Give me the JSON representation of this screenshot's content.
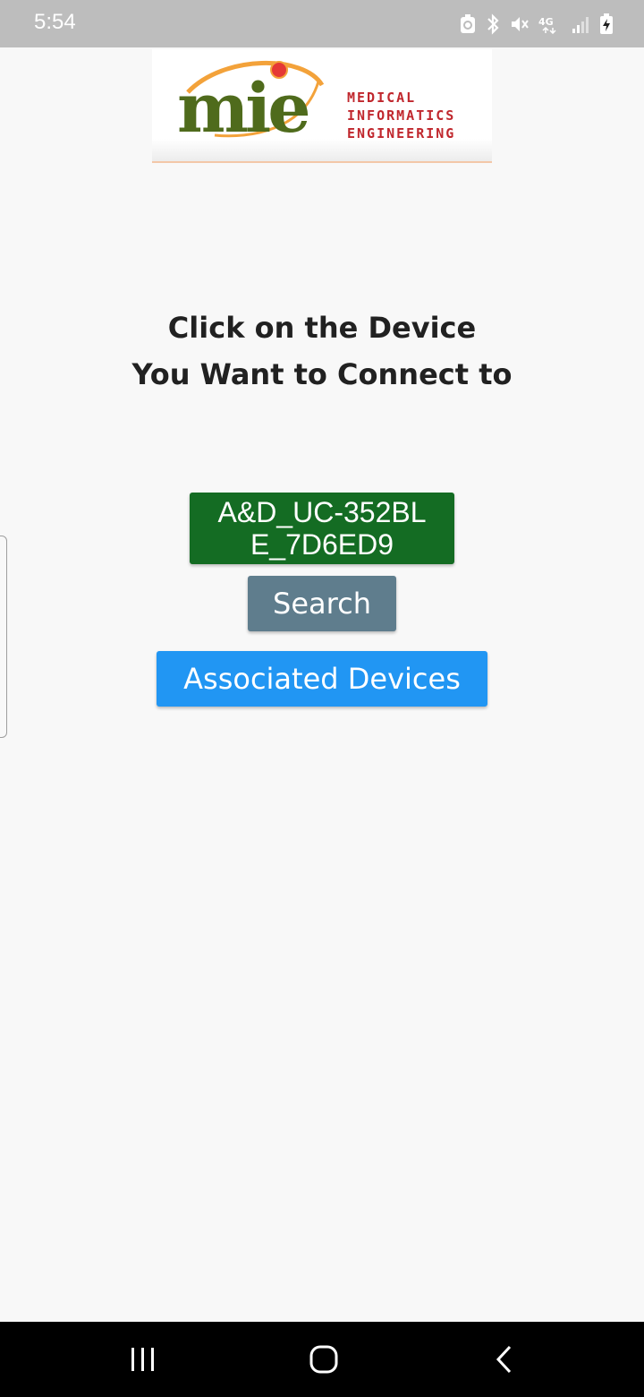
{
  "status_bar": {
    "time": "5:54",
    "icons": [
      "sync-icon",
      "bluetooth-icon",
      "mute-icon",
      "network-4g-icon",
      "signal-icon",
      "battery-charging-icon"
    ],
    "network_label": "4G"
  },
  "logo": {
    "mark": "mie",
    "lines": [
      "MEDICAL",
      "INFORMATICS",
      "ENGINEERING"
    ],
    "colors": {
      "mark": "#4f6b1c",
      "text": "#c0272d",
      "orbit": "#f3a23a"
    }
  },
  "prompt": {
    "line1": "Click on the Device",
    "line2": "You Want to Connect to"
  },
  "buttons": {
    "device": {
      "line1": "A&D_UC-352BL",
      "line2": "E_7D6ED9",
      "color": "#146c23"
    },
    "search": {
      "label": "Search",
      "color": "#5f7d8d"
    },
    "associated": {
      "label": "Associated Devices",
      "color": "#2196f3"
    }
  },
  "nav_bar": {
    "icons": [
      "recent-apps-icon",
      "home-icon",
      "back-icon"
    ]
  }
}
